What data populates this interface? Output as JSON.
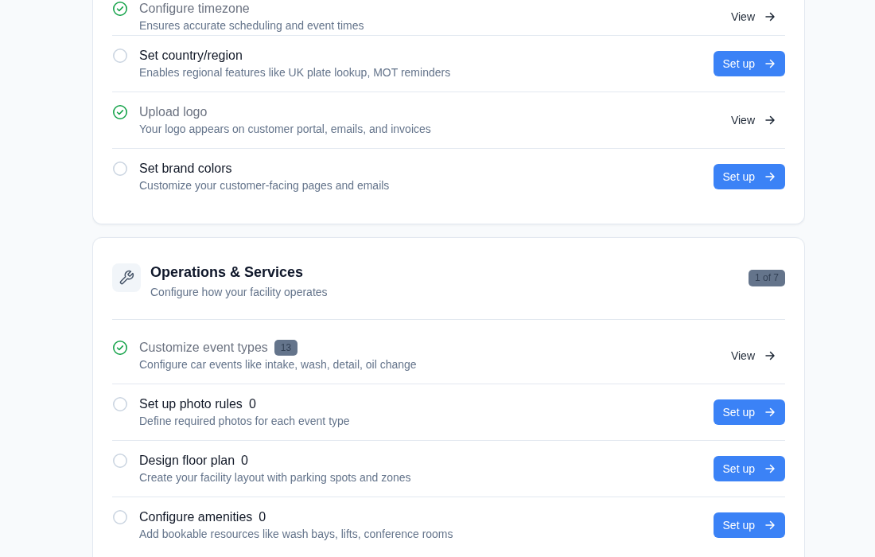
{
  "sections": [
    {
      "items": [
        {
          "title": "Configure timezone",
          "description": "Ensures accurate scheduling and event times",
          "done": true,
          "action": "View"
        },
        {
          "title": "Set country/region",
          "description": "Enables regional features like UK plate lookup, MOT reminders",
          "done": false,
          "action": "Set up"
        },
        {
          "title": "Upload logo",
          "description": "Your logo appears on customer portal, emails, and invoices",
          "done": true,
          "action": "View"
        },
        {
          "title": "Set brand colors",
          "description": "Customize your customer-facing pages and emails",
          "done": false,
          "action": "Set up"
        }
      ]
    },
    {
      "title": "Operations & Services",
      "subtitle": "Configure how your facility operates",
      "progress": "1 of 7",
      "items": [
        {
          "title": "Customize event types",
          "count": "13",
          "kind": "badge",
          "description": "Configure car events like intake, wash, detail, oil change",
          "done": true,
          "action": "View"
        },
        {
          "title": "Set up photo rules",
          "count": "0",
          "kind": "plain",
          "description": "Define required photos for each event type",
          "done": false,
          "action": "Set up"
        },
        {
          "title": "Design floor plan",
          "count": "0",
          "kind": "plain",
          "description": "Create your facility layout with parking spots and zones",
          "done": false,
          "action": "Set up"
        },
        {
          "title": "Configure amenities",
          "count": "0",
          "kind": "plain",
          "description": "Add bookable resources like wash bays, lifts, conference rooms",
          "done": false,
          "action": "Set up"
        }
      ]
    }
  ]
}
